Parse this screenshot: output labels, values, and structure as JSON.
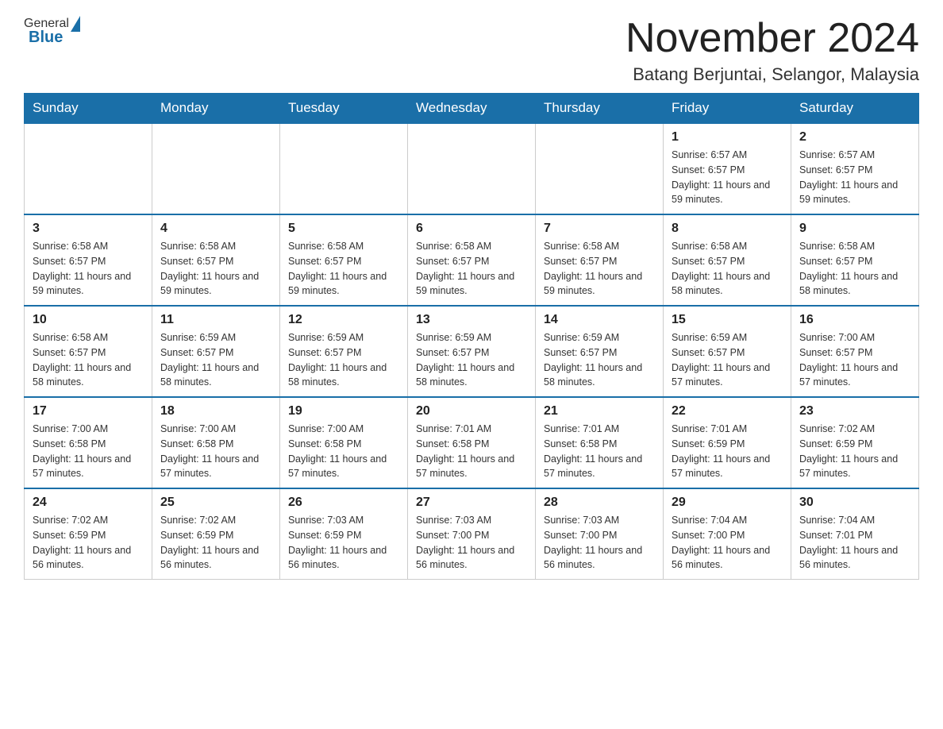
{
  "logo": {
    "general": "General",
    "blue": "Blue"
  },
  "header": {
    "month": "November 2024",
    "location": "Batang Berjuntai, Selangor, Malaysia"
  },
  "weekdays": [
    "Sunday",
    "Monday",
    "Tuesday",
    "Wednesday",
    "Thursday",
    "Friday",
    "Saturday"
  ],
  "weeks": [
    [
      {
        "day": "",
        "info": ""
      },
      {
        "day": "",
        "info": ""
      },
      {
        "day": "",
        "info": ""
      },
      {
        "day": "",
        "info": ""
      },
      {
        "day": "",
        "info": ""
      },
      {
        "day": "1",
        "info": "Sunrise: 6:57 AM\nSunset: 6:57 PM\nDaylight: 11 hours and 59 minutes."
      },
      {
        "day": "2",
        "info": "Sunrise: 6:57 AM\nSunset: 6:57 PM\nDaylight: 11 hours and 59 minutes."
      }
    ],
    [
      {
        "day": "3",
        "info": "Sunrise: 6:58 AM\nSunset: 6:57 PM\nDaylight: 11 hours and 59 minutes."
      },
      {
        "day": "4",
        "info": "Sunrise: 6:58 AM\nSunset: 6:57 PM\nDaylight: 11 hours and 59 minutes."
      },
      {
        "day": "5",
        "info": "Sunrise: 6:58 AM\nSunset: 6:57 PM\nDaylight: 11 hours and 59 minutes."
      },
      {
        "day": "6",
        "info": "Sunrise: 6:58 AM\nSunset: 6:57 PM\nDaylight: 11 hours and 59 minutes."
      },
      {
        "day": "7",
        "info": "Sunrise: 6:58 AM\nSunset: 6:57 PM\nDaylight: 11 hours and 59 minutes."
      },
      {
        "day": "8",
        "info": "Sunrise: 6:58 AM\nSunset: 6:57 PM\nDaylight: 11 hours and 58 minutes."
      },
      {
        "day": "9",
        "info": "Sunrise: 6:58 AM\nSunset: 6:57 PM\nDaylight: 11 hours and 58 minutes."
      }
    ],
    [
      {
        "day": "10",
        "info": "Sunrise: 6:58 AM\nSunset: 6:57 PM\nDaylight: 11 hours and 58 minutes."
      },
      {
        "day": "11",
        "info": "Sunrise: 6:59 AM\nSunset: 6:57 PM\nDaylight: 11 hours and 58 minutes."
      },
      {
        "day": "12",
        "info": "Sunrise: 6:59 AM\nSunset: 6:57 PM\nDaylight: 11 hours and 58 minutes."
      },
      {
        "day": "13",
        "info": "Sunrise: 6:59 AM\nSunset: 6:57 PM\nDaylight: 11 hours and 58 minutes."
      },
      {
        "day": "14",
        "info": "Sunrise: 6:59 AM\nSunset: 6:57 PM\nDaylight: 11 hours and 58 minutes."
      },
      {
        "day": "15",
        "info": "Sunrise: 6:59 AM\nSunset: 6:57 PM\nDaylight: 11 hours and 57 minutes."
      },
      {
        "day": "16",
        "info": "Sunrise: 7:00 AM\nSunset: 6:57 PM\nDaylight: 11 hours and 57 minutes."
      }
    ],
    [
      {
        "day": "17",
        "info": "Sunrise: 7:00 AM\nSunset: 6:58 PM\nDaylight: 11 hours and 57 minutes."
      },
      {
        "day": "18",
        "info": "Sunrise: 7:00 AM\nSunset: 6:58 PM\nDaylight: 11 hours and 57 minutes."
      },
      {
        "day": "19",
        "info": "Sunrise: 7:00 AM\nSunset: 6:58 PM\nDaylight: 11 hours and 57 minutes."
      },
      {
        "day": "20",
        "info": "Sunrise: 7:01 AM\nSunset: 6:58 PM\nDaylight: 11 hours and 57 minutes."
      },
      {
        "day": "21",
        "info": "Sunrise: 7:01 AM\nSunset: 6:58 PM\nDaylight: 11 hours and 57 minutes."
      },
      {
        "day": "22",
        "info": "Sunrise: 7:01 AM\nSunset: 6:59 PM\nDaylight: 11 hours and 57 minutes."
      },
      {
        "day": "23",
        "info": "Sunrise: 7:02 AM\nSunset: 6:59 PM\nDaylight: 11 hours and 57 minutes."
      }
    ],
    [
      {
        "day": "24",
        "info": "Sunrise: 7:02 AM\nSunset: 6:59 PM\nDaylight: 11 hours and 56 minutes."
      },
      {
        "day": "25",
        "info": "Sunrise: 7:02 AM\nSunset: 6:59 PM\nDaylight: 11 hours and 56 minutes."
      },
      {
        "day": "26",
        "info": "Sunrise: 7:03 AM\nSunset: 6:59 PM\nDaylight: 11 hours and 56 minutes."
      },
      {
        "day": "27",
        "info": "Sunrise: 7:03 AM\nSunset: 7:00 PM\nDaylight: 11 hours and 56 minutes."
      },
      {
        "day": "28",
        "info": "Sunrise: 7:03 AM\nSunset: 7:00 PM\nDaylight: 11 hours and 56 minutes."
      },
      {
        "day": "29",
        "info": "Sunrise: 7:04 AM\nSunset: 7:00 PM\nDaylight: 11 hours and 56 minutes."
      },
      {
        "day": "30",
        "info": "Sunrise: 7:04 AM\nSunset: 7:01 PM\nDaylight: 11 hours and 56 minutes."
      }
    ]
  ]
}
